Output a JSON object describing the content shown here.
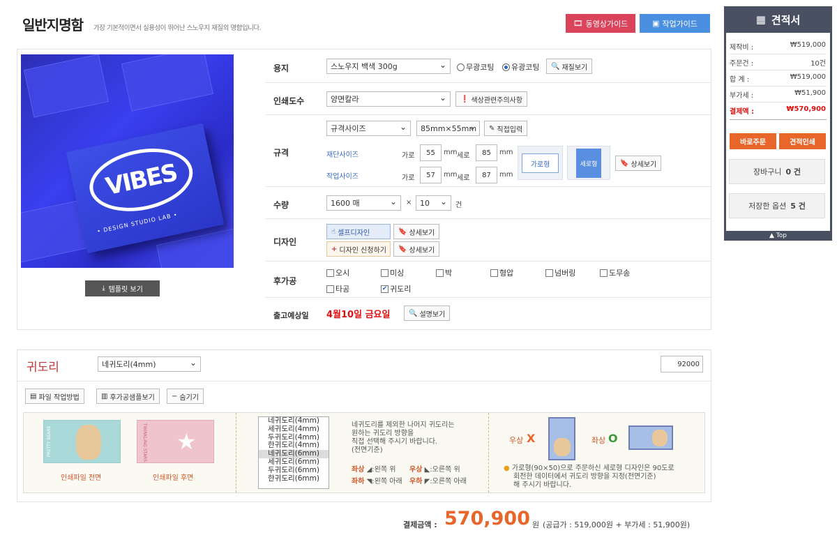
{
  "header": {
    "title": "일반지명함",
    "subtitle": "가장 기본적이면서 실용성이 뛰어난 스노우지 재질의 명함입니다.",
    "btn_video": "동영상가이드",
    "btn_work": "작업가이드"
  },
  "photo": {
    "logo_text": "VIBES",
    "tagline": "• DESIGN STUDIO LAB •"
  },
  "template_btn": "템플릿 보기",
  "form": {
    "paper": {
      "label": "용지",
      "value": "스노우지 백색 300g",
      "radio1": "무광코팅",
      "radio2": "유광코팅",
      "btn": "재질보기"
    },
    "color": {
      "label": "인쇄도수",
      "value": "양면칼라",
      "btn": "색상관련주의사항"
    },
    "size": {
      "label": "규격",
      "type": "규격사이즈",
      "dim": "85mm×55mm",
      "direct": "직접입력",
      "cut_label": "재단사이즈",
      "work_label": "작업사이즈",
      "w_label": "가로",
      "h_label": "세로",
      "mm": "mm",
      "cut_w": "55",
      "cut_h": "85",
      "work_w": "57",
      "work_h": "87",
      "landscape": "가로형",
      "portrait": "세로형",
      "detail": "상세보기"
    },
    "qty": {
      "label": "수량",
      "value": "1600 매",
      "times": "×",
      "count": "10",
      "unit": "건"
    },
    "design": {
      "label": "디자인",
      "self": "셀프디자인",
      "request": "디자인 신청하기",
      "detail": "상세보기"
    },
    "finishing": {
      "label": "후가공",
      "items": [
        "오시",
        "미싱",
        "박",
        "형압",
        "넘버링",
        "도무송",
        "타공",
        "귀도리"
      ]
    },
    "ship": {
      "label": "출고예상일",
      "date": "4월10일 금요일",
      "btn": "설명보기"
    }
  },
  "quote": {
    "title": "견적서",
    "rows": [
      {
        "k": "제작비 :",
        "v": "₩519,000"
      },
      {
        "k": "주문건 :",
        "v": "10건"
      },
      {
        "k": "합   계 :",
        "v": "₩519,000"
      },
      {
        "k": "부가세 :",
        "v": "₩51,900"
      }
    ],
    "total_k": "결제액 :",
    "total_v": "₩570,900",
    "order": "바로주문",
    "print": "견적인쇄",
    "cart": "장바구니",
    "cart_count": "0 건",
    "saved": "저장한 옵션",
    "saved_count": "5 건",
    "top": "▲ Top"
  },
  "corner": {
    "title": "귀도리",
    "select": "네귀도리(4mm)",
    "amount": "92000",
    "btn_file": "파일 작업방법",
    "btn_sample": "후가공샘플보기",
    "btn_hide": "숨기기",
    "front_label": "인쇄파일 전면",
    "back_label": "인쇄파일 후면",
    "front_text": "PRETTY BEARS",
    "back_text": "TWINKLING STARS",
    "list": [
      "네귀도리(4mm)",
      "세귀도리(4mm)",
      "두귀도리(4mm)",
      "한귀도리(4mm)",
      "네귀도리(6mm)",
      "세귀도리(6mm)",
      "두귀도리(6mm)",
      "한귀도리(6mm)"
    ],
    "instr1": "네귀도리를 제외한 나머지 귀도리는",
    "instr2": "원하는 귀도리 방향을",
    "instr3": "직접 선택해 주시기 바랍니다.",
    "instr4": "(전면기준)",
    "tl_k": "좌상",
    "tl_v": ":왼쪽 위",
    "tr_k": "우상",
    "tr_v": ":오른쪽 위",
    "bl_k": "좌하",
    "bl_v": ":왼쪽 아래",
    "br_k": "우하",
    "br_v": ":오른쪽 아래",
    "wrong_label": "우상",
    "wrong_mark": "X",
    "right_label": "좌상",
    "right_mark": "O",
    "note1": "가로형(90×50)으로 주문하신 세로형 디자인은 90도로",
    "note2": "회전한 데이터에서 귀도리 방향을 지정(전면기준)",
    "note3": "해 주시기 바랍니다."
  },
  "total": {
    "label": "결제금액 :",
    "value": "570,900",
    "unit": "원",
    "detail": "(공급가 : 519,000원 + 부가세 : 51,900원)"
  },
  "colors": {
    "accent_orange": "#e8662a",
    "red_btn": "#d9445a",
    "blue_btn": "#4a8fe0",
    "quote_bg": "#485062"
  }
}
